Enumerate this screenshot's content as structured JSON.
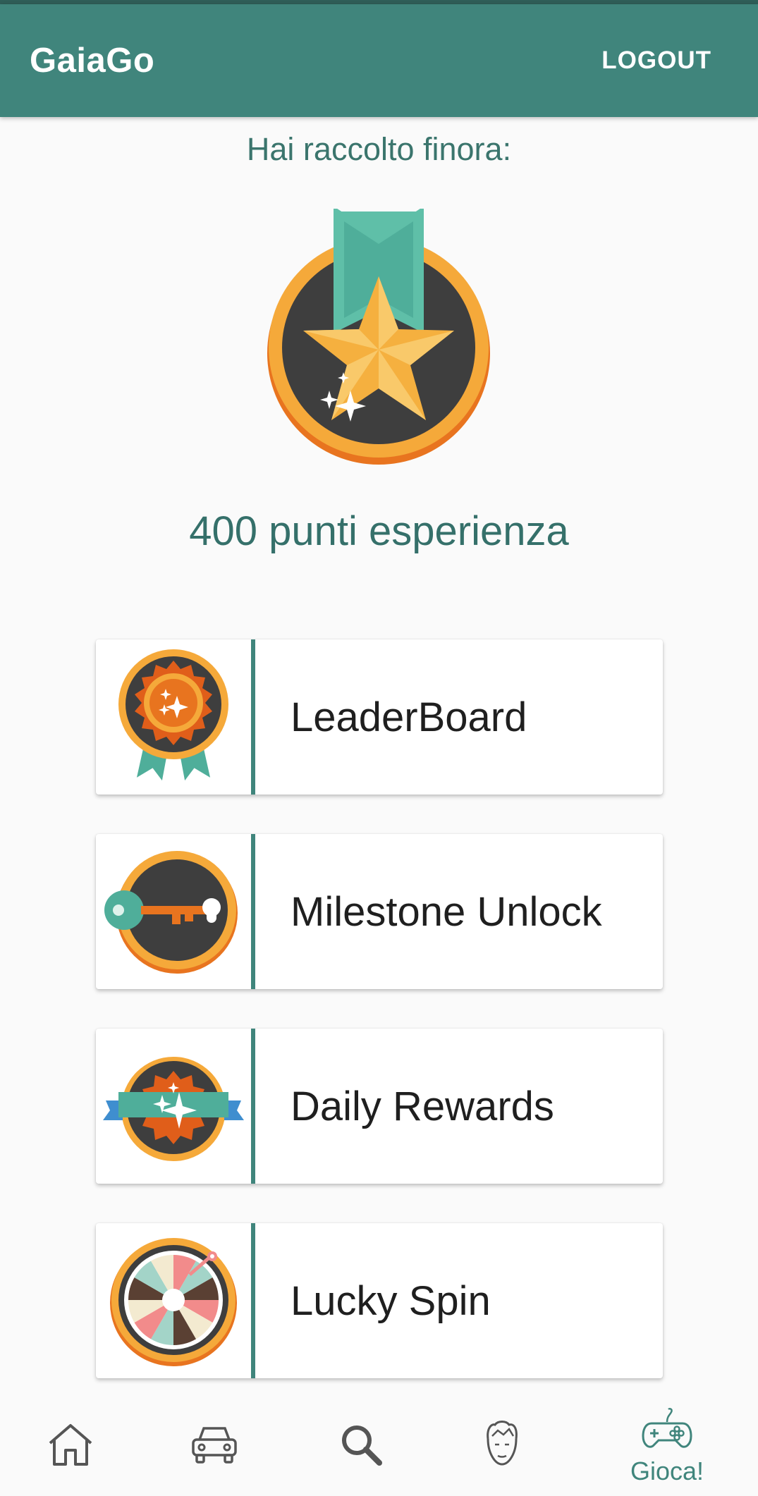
{
  "app": {
    "title": "GaiaGo",
    "logout_label": "LOGOUT"
  },
  "summary": {
    "intro": "Hai raccolto finora:",
    "points": "400 punti esperienza"
  },
  "menu": [
    {
      "label": "LeaderBoard",
      "icon": "rosette-award-icon"
    },
    {
      "label": "Milestone Unlock",
      "icon": "key-medal-icon"
    },
    {
      "label": "Daily Rewards",
      "icon": "ribbon-sparkle-icon"
    },
    {
      "label": "Lucky Spin",
      "icon": "prize-wheel-icon"
    }
  ],
  "bottom_nav": {
    "items": [
      {
        "icon": "home-icon"
      },
      {
        "icon": "car-icon"
      },
      {
        "icon": "search-icon"
      },
      {
        "icon": "profile-face-icon"
      },
      {
        "icon": "gamepad-icon",
        "label": "Gioca!",
        "active": true
      }
    ]
  },
  "colors": {
    "primary": "#40857c",
    "accent_orange": "#f5a93a",
    "dark": "#3e3e3e",
    "teal": "#4fae9a"
  }
}
